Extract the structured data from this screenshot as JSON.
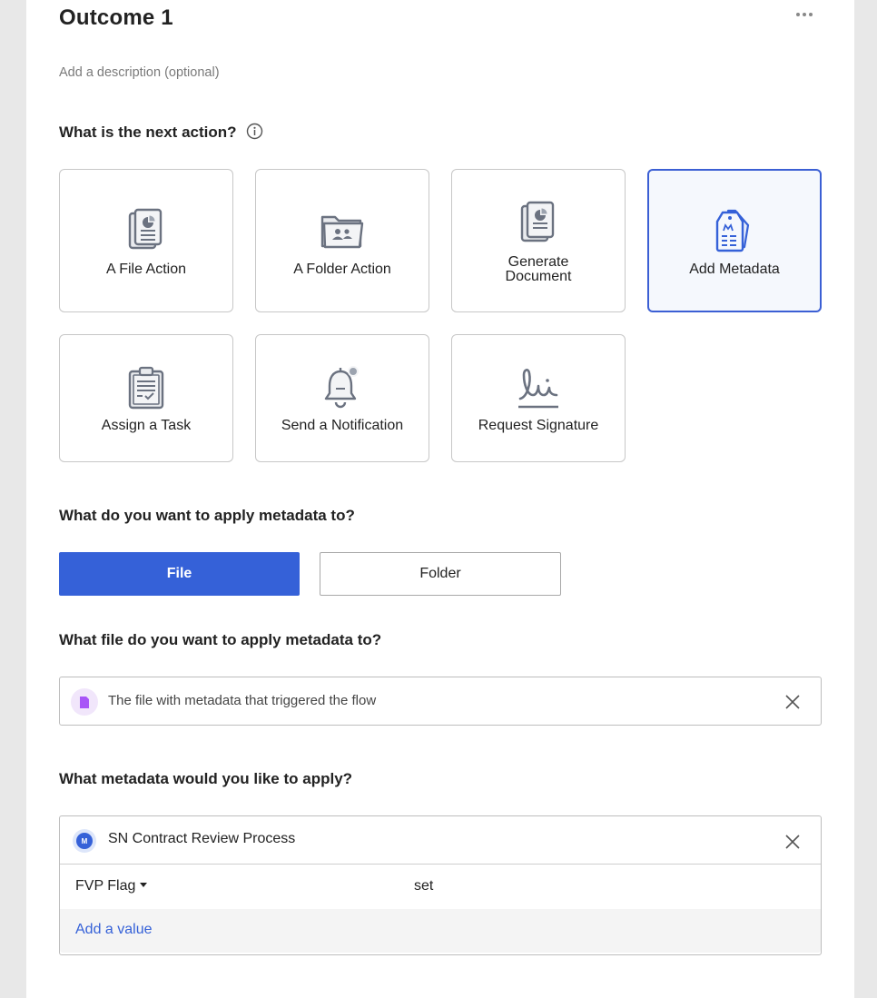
{
  "outcome": {
    "title": "Outcome 1",
    "description_placeholder": "Add a description (optional)"
  },
  "colors": {
    "accent": "#3561d8",
    "selected_border": "#3b5fd4",
    "icon_gray": "#6b7280",
    "file_purple": "#a855f7"
  },
  "next_action": {
    "question": "What is the next action?",
    "selected": "Add Metadata",
    "options": [
      {
        "label": "A File Action",
        "icon": "file-action-icon"
      },
      {
        "label": "A Folder Action",
        "icon": "folder-action-icon"
      },
      {
        "label": "Generate\nDocument",
        "icon": "generate-document-icon"
      },
      {
        "label": "Add Metadata",
        "icon": "metadata-tag-icon"
      },
      {
        "label": "Assign a Task",
        "icon": "clipboard-task-icon"
      },
      {
        "label": "Send a Notification",
        "icon": "bell-icon"
      },
      {
        "label": "Request Signature",
        "icon": "signature-icon"
      }
    ]
  },
  "apply_to": {
    "question": "What do you want to apply metadata to?",
    "selected": "File",
    "options": [
      "File",
      "Folder"
    ]
  },
  "target_file": {
    "question": "What file do you want to apply metadata to?",
    "value": "The file with metadata that triggered the flow",
    "icon": "file-icon"
  },
  "metadata": {
    "question": "What metadata would you like to apply?",
    "template_badge": "M",
    "template_name": "SN Contract Review Process",
    "field_name": "FVP Flag",
    "field_value": "set",
    "add_value_label": "Add a value"
  }
}
